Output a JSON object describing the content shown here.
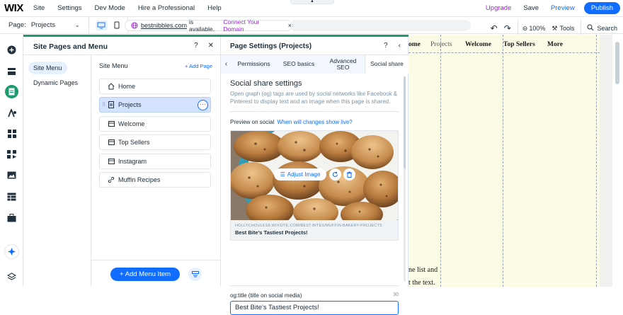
{
  "topbar": {
    "logo": "WIX",
    "menu": [
      "Site",
      "Settings",
      "Dev Mode",
      "Hire a Professional",
      "Help"
    ],
    "upgrade": "Upgrade",
    "save": "Save",
    "preview": "Preview",
    "publish": "Publish"
  },
  "secondbar": {
    "page_label": "Page:",
    "page_value": "Projects",
    "domain": "bestnibbles.com",
    "domain_status": "is available.",
    "connect": "Connect Your Domain",
    "zoom": "100%",
    "tools": "Tools",
    "search": "Search"
  },
  "sitepages": {
    "title": "Site Pages and Menu",
    "nav": [
      "Site Menu",
      "Dynamic Pages"
    ],
    "menu_heading": "Site Menu",
    "add_page": "+ Add Page",
    "pages": [
      {
        "label": "Home",
        "icon": "home-icon"
      },
      {
        "label": "Projects",
        "icon": "page-icon"
      },
      {
        "label": "Welcome",
        "icon": "section-icon"
      },
      {
        "label": "Top Sellers",
        "icon": "section-icon"
      },
      {
        "label": "Instagram",
        "icon": "section-icon"
      },
      {
        "label": "Muffin Recipes",
        "icon": "link-icon"
      }
    ],
    "add_menu_item": "+ Add Menu Item"
  },
  "pagesettings": {
    "title": "Page Settings (Projects)",
    "tabs": [
      "Permissions",
      "SEO basics",
      "Advanced SEO",
      "Social share"
    ],
    "section_title": "Social share settings",
    "description": "Open graph (og) tags are used by social networks like Facebook & Pinterest to display text and an image when this page is shared.",
    "preview_label": "Preview on social",
    "preview_link": "When will changes show live?",
    "adjust_image": "Adjust Image",
    "card_url": "HOLLYCHOULES8.WIXSITE.COM/BEST-BITES/MUFFIN-BAKERY-PROJECTS",
    "card_title": "Best Bite's Tastiest Projects!",
    "og_label": "og:title (title on social media)",
    "og_count": "30",
    "og_value": "Best Bite's Tastiest Projects!"
  },
  "canvas": {
    "nav": [
      "ome",
      "Projects",
      "Welcome",
      "Top Sellers",
      "More"
    ],
    "body_lines": [
      "ne list and",
      "t the text."
    ]
  },
  "colors": {
    "accent": "#116dff",
    "upgrade": "#9a27d5",
    "panel_accent": "#1d9b6f",
    "canvas_bg": "#fbfbe6"
  }
}
